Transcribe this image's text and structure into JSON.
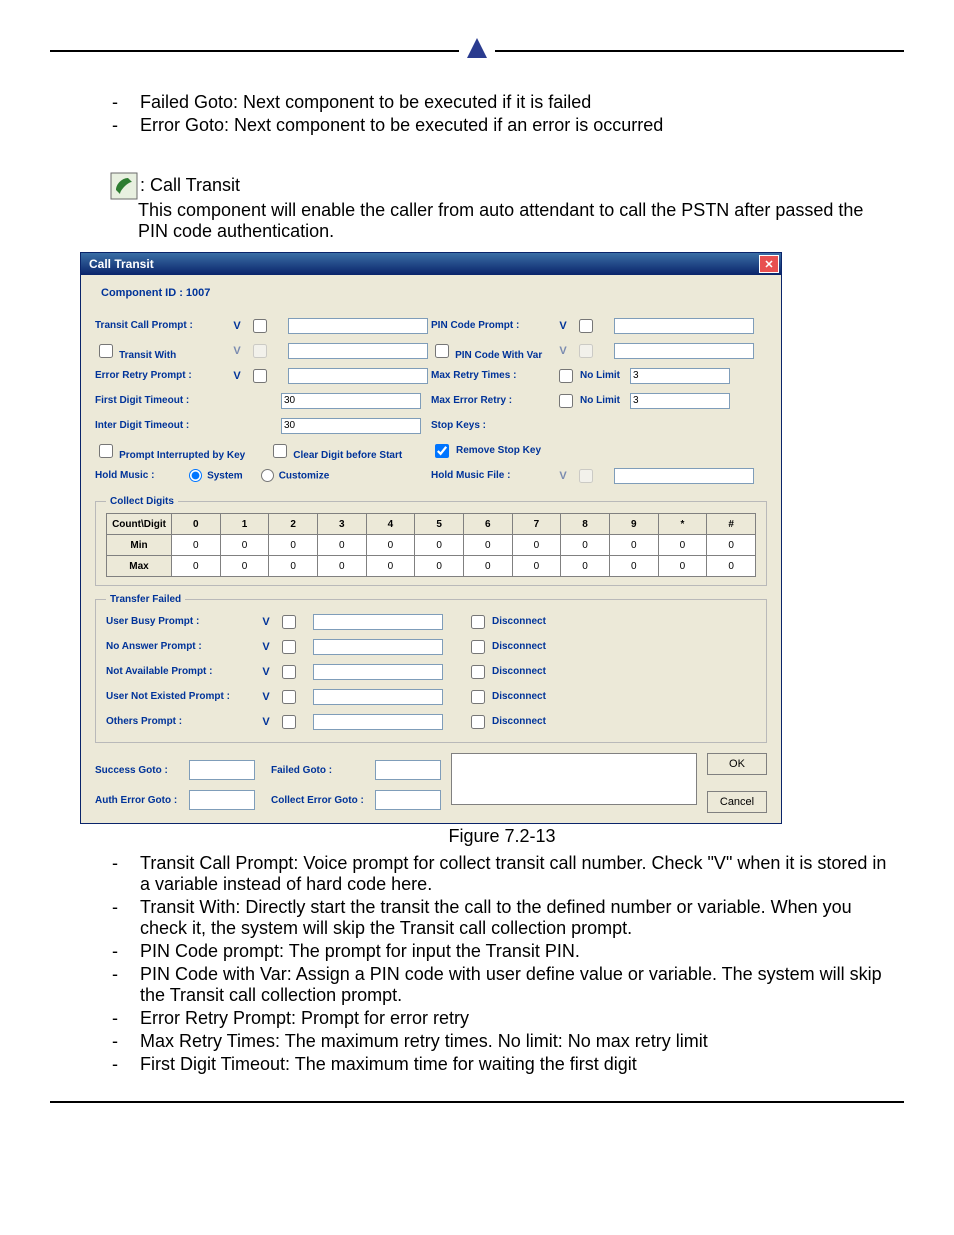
{
  "doc": {
    "intro_bullets": {
      "b1": "Failed Goto: Next component to be executed if it is failed",
      "b2": "Error Goto: Next component to be executed if an error is occurred"
    },
    "section_title_suffix": ": Call Transit",
    "section_desc": "This component will enable the caller from auto attendant to call the PSTN after passed the PIN code authentication.",
    "figure_caption": "Figure 7.2-13",
    "after_bullets": {
      "b1": "Transit Call Prompt: Voice prompt for collect transit call number. Check \"V\" when it is stored in a variable instead of hard code here.",
      "b2": "Transit With: Directly start the transit the call to the defined number or variable. When you check it, the system will skip the Transit call collection prompt.",
      "b3": "PIN Code prompt: The prompt for input the Transit PIN.",
      "b4": "PIN Code with Var: Assign a PIN code with user define value or variable. The system will skip the Transit call collection prompt.",
      "b5": "Error Retry Prompt: Prompt for error retry",
      "b6": "Max Retry Times: The maximum retry times. No limit: No max retry limit",
      "b7": "First Digit Timeout: The maximum time for waiting the first digit"
    }
  },
  "dlg": {
    "title": "Call Transit",
    "component_id": "Component ID : 1007",
    "left": {
      "transit_call_prompt": "Transit Call Prompt :",
      "transit_with": "Transit With",
      "error_retry_prompt": "Error Retry Prompt :",
      "first_digit_timeout": "First Digit Timeout :",
      "first_digit_timeout_val": "30",
      "inter_digit_timeout": "Inter Digit Timeout :",
      "inter_digit_timeout_val": "30",
      "prompt_interrupted": "Prompt Interrupted by Key",
      "clear_digit": "Clear Digit before Start",
      "hold_music": "Hold Music :",
      "system": "System",
      "customize": "Customize"
    },
    "right": {
      "pin_code_prompt": "PIN Code Prompt :",
      "pin_code_var": "PIN Code With Var",
      "max_retry": "Max Retry Times :",
      "max_retry_val": "3",
      "max_error_retry": "Max Error Retry :",
      "max_error_retry_val": "3",
      "no_limit": "No Limit",
      "stop_keys": "Stop Keys :",
      "remove_stop_key": "Remove Stop Key",
      "hold_music_file": "Hold Music File :"
    },
    "v_label": "V",
    "collect_legend": "Collect Digits",
    "collect_headers": {
      "count": "Count\\Digit",
      "c0": "0",
      "c1": "1",
      "c2": "2",
      "c3": "3",
      "c4": "4",
      "c5": "5",
      "c6": "6",
      "c7": "7",
      "c8": "8",
      "c9": "9",
      "star": "*",
      "hash": "#"
    },
    "collect_rows": {
      "min": "Min",
      "max": "Max"
    },
    "zero": "0",
    "tf_legend": "Transfer Failed",
    "tf": {
      "user_busy": "User Busy Prompt :",
      "no_answer": "No Answer Prompt :",
      "not_available": "Not Available Prompt :",
      "user_not_exist": "User Not Existed Prompt :",
      "others": "Others Prompt :",
      "disconnect": "Disconnect"
    },
    "goto": {
      "success": "Success Goto :",
      "failed": "Failed Goto :",
      "auth_err": "Auth Error Goto :",
      "collect_err": "Collect Error Goto :"
    },
    "ok": "OK",
    "cancel": "Cancel"
  }
}
